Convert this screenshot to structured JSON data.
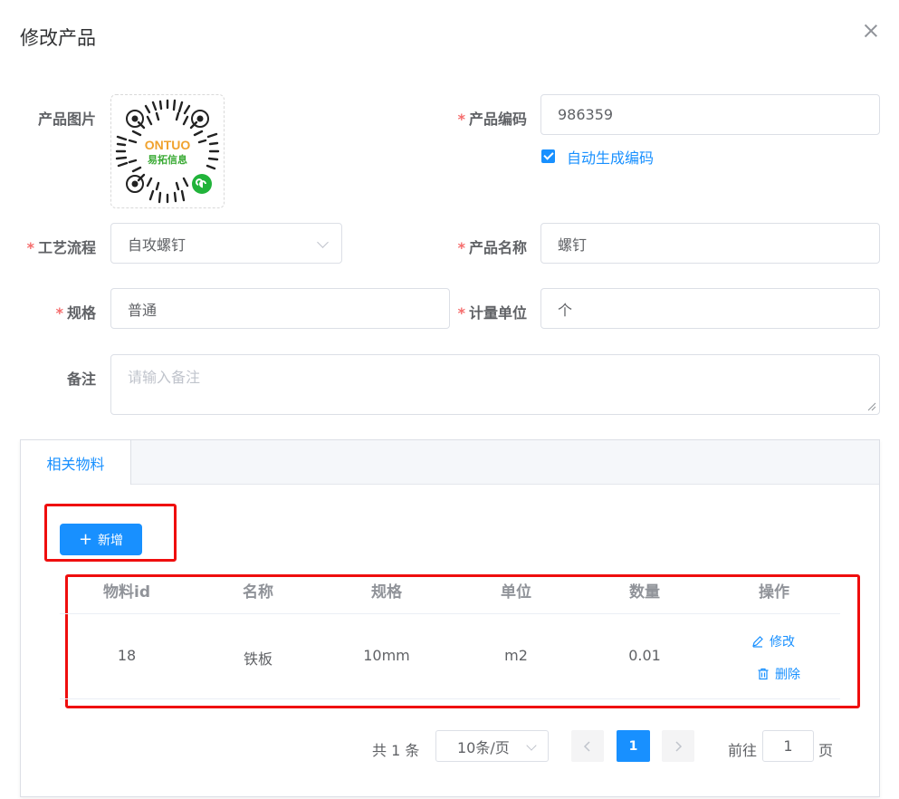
{
  "dialog": {
    "title": "修改产品"
  },
  "form": {
    "product_image": {
      "label": "产品图片",
      "logo_text_top": "ONTUO",
      "logo_text_bottom": "易拓信息"
    },
    "product_code": {
      "label": "产品编码",
      "value": "986359"
    },
    "auto_code": {
      "label": "自动生成编码",
      "checked": true
    },
    "process_flow": {
      "label": "工艺流程",
      "value": "自攻螺钉"
    },
    "product_name": {
      "label": "产品名称",
      "value": "螺钉"
    },
    "spec": {
      "label": "规格",
      "value": "普通"
    },
    "unit": {
      "label": "计量单位",
      "value": "个"
    },
    "remark": {
      "label": "备注",
      "placeholder": "请输入备注"
    }
  },
  "tabs": [
    {
      "label": "相关物料",
      "active": true
    }
  ],
  "toolbar": {
    "add_label": "新增"
  },
  "table": {
    "columns": [
      "物料id",
      "名称",
      "规格",
      "单位",
      "数量",
      "操作"
    ],
    "rows": [
      {
        "id": "18",
        "name": "铁板",
        "spec": "10mm",
        "unit": "m2",
        "qty": "0.01",
        "edit_label": "修改",
        "delete_label": "删除"
      }
    ]
  },
  "pagination": {
    "total_text": "共 1 条",
    "page_size": "10条/页",
    "current_page": "1",
    "goto_prefix": "前往",
    "goto_value": "1",
    "goto_suffix": "页"
  },
  "colors": {
    "primary": "#1890ff",
    "required": "#f56c6c",
    "highlight_box": "#ef0e0e"
  }
}
